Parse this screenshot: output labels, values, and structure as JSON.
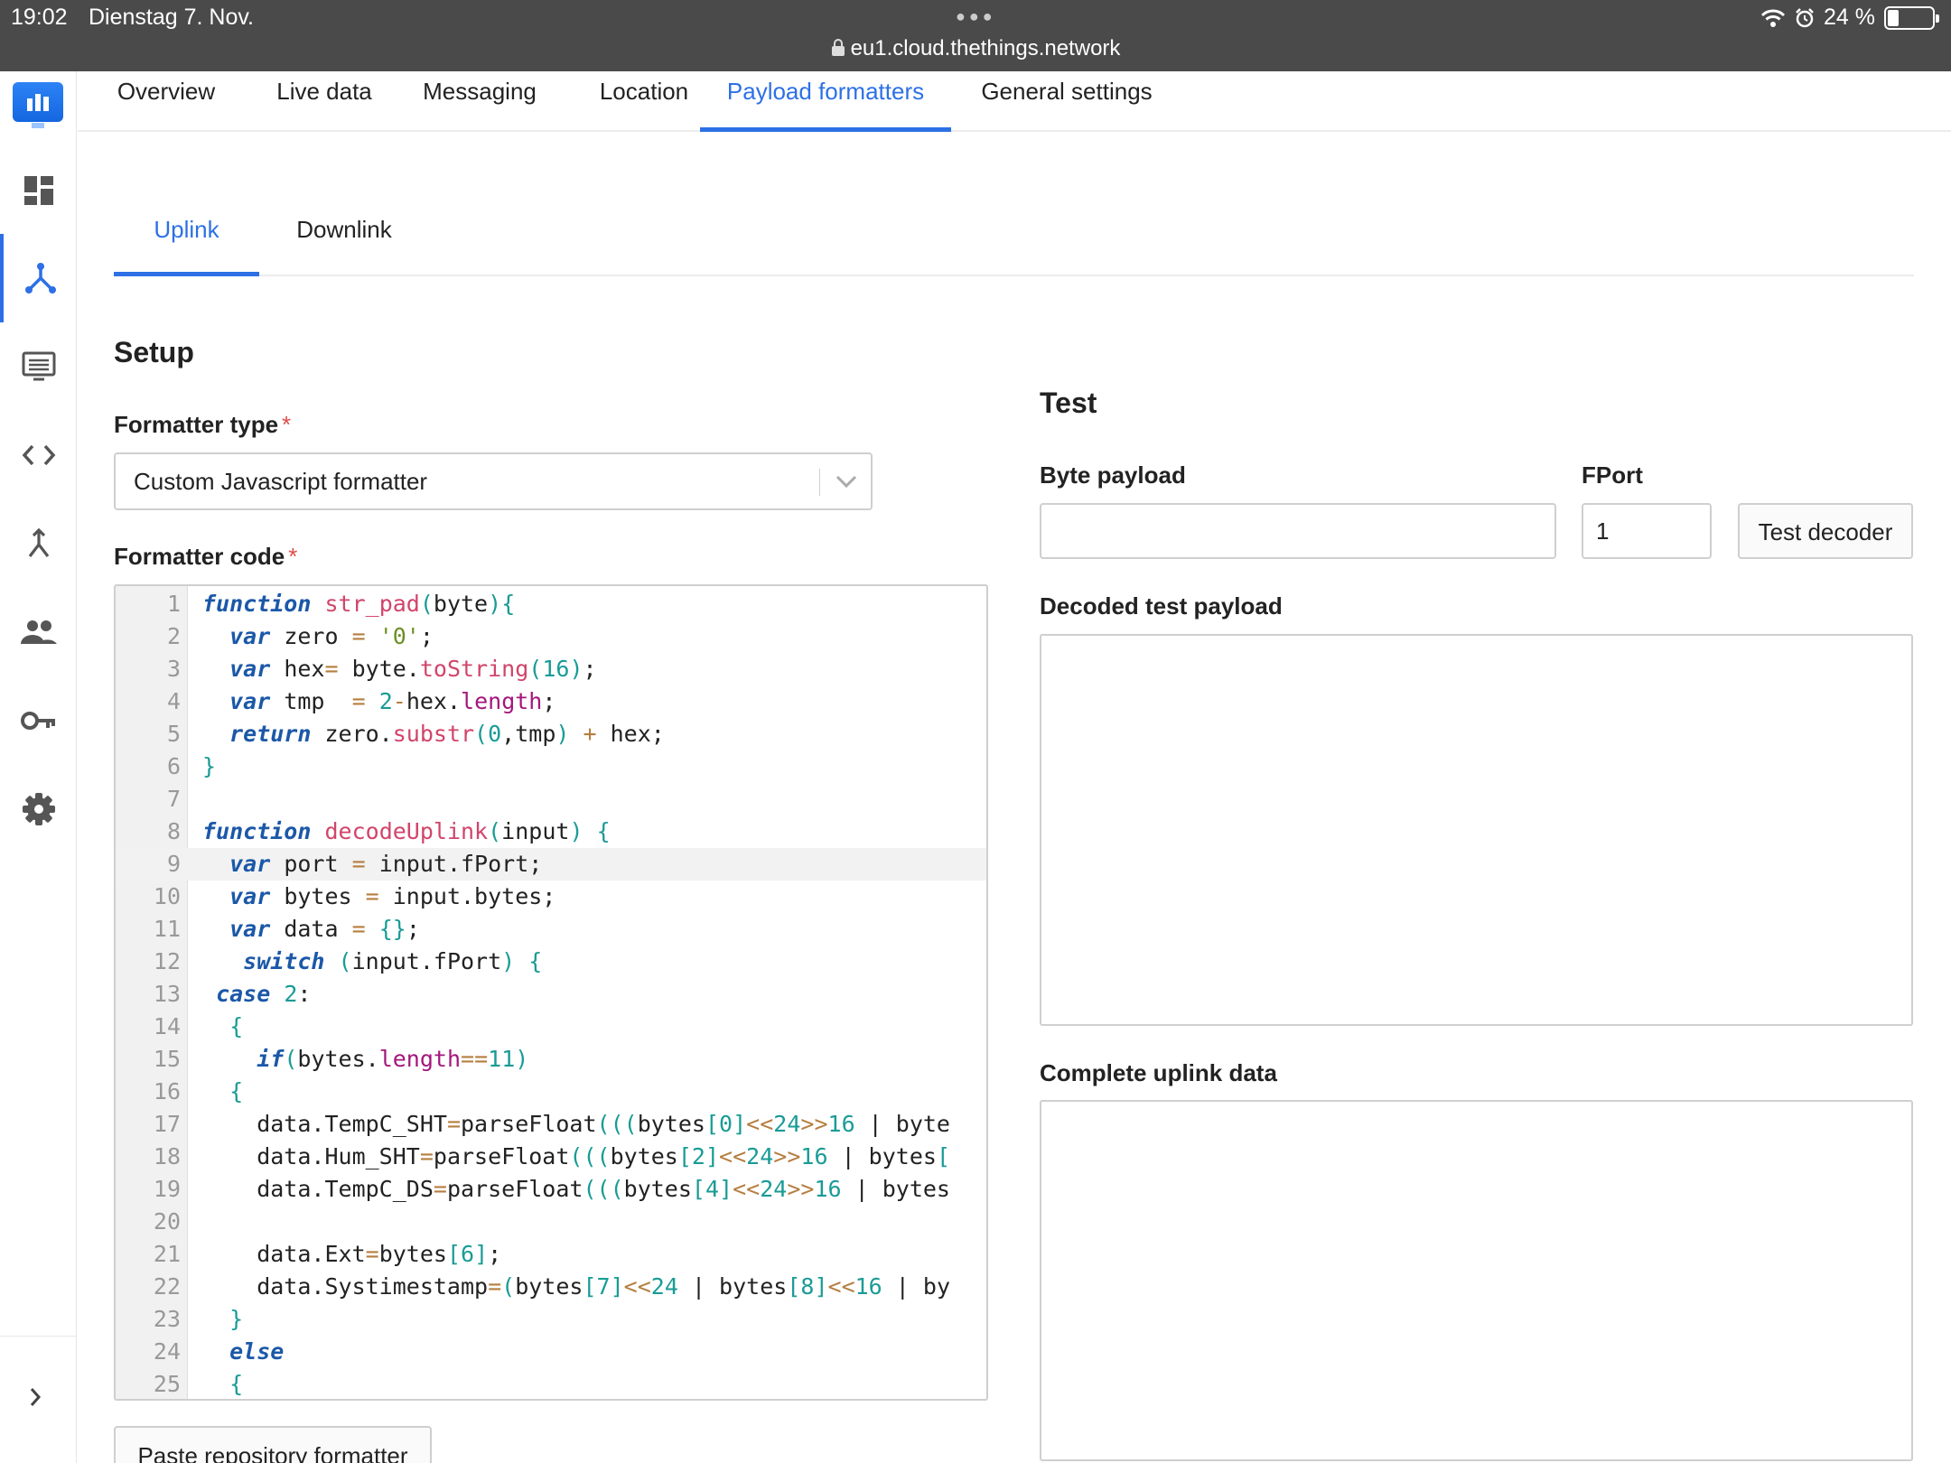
{
  "status_bar": {
    "time": "19:02",
    "date": "Dienstag 7. Nov.",
    "url": "eu1.cloud.thethings.network",
    "battery": "24 %",
    "battery_level": 0.24
  },
  "sidebar": {
    "items": [
      {
        "icon": "dashboard-icon"
      },
      {
        "icon": "applications-icon",
        "active": true
      },
      {
        "icon": "gateways-icon"
      },
      {
        "icon": "code-icon"
      },
      {
        "icon": "merge-icon"
      },
      {
        "icon": "people-icon"
      },
      {
        "icon": "key-icon"
      },
      {
        "icon": "gear-icon"
      }
    ],
    "collapse_icon": "chevron-right-icon"
  },
  "top_tabs": [
    {
      "label": "Overview"
    },
    {
      "label": "Live data"
    },
    {
      "label": "Messaging"
    },
    {
      "label": "Location"
    },
    {
      "label": "Payload formatters",
      "active": true
    },
    {
      "label": "General settings"
    }
  ],
  "sub_tabs": [
    {
      "label": "Uplink",
      "active": true
    },
    {
      "label": "Downlink"
    }
  ],
  "setup": {
    "title": "Setup",
    "formatter_type_label": "Formatter type",
    "formatter_type_value": "Custom Javascript formatter",
    "formatter_code_label": "Formatter code",
    "required_mark": "*",
    "paste_button": "Paste repository formatter"
  },
  "code_lines": [
    "function str_pad(byte){",
    "  var zero = '0';",
    "  var hex= byte.toString(16);",
    "  var tmp  = 2-hex.length;",
    "  return zero.substr(0,tmp) + hex;",
    "}",
    "",
    "function decodeUplink(input) {",
    "  var port = input.fPort;",
    "  var bytes = input.bytes;",
    "  var data = {};",
    "   switch (input.fPort) {",
    " case 2:",
    "  {",
    "    if(bytes.length==11)",
    "  {",
    "    data.TempC_SHT=parseFloat(((bytes[0]<<24>>16 | byte",
    "    data.Hum_SHT=parseFloat(((bytes[2]<<24>>16 | bytes[",
    "    data.TempC_DS=parseFloat(((bytes[4]<<24>>16 | bytes",
    "",
    "    data.Ext=bytes[6];",
    "    data.Systimestamp=(bytes[7]<<24 | bytes[8]<<16 | by",
    "  }",
    "  else",
    "  {"
  ],
  "test": {
    "title": "Test",
    "byte_payload_label": "Byte payload",
    "byte_payload_value": "",
    "fport_label": "FPort",
    "fport_value": "1",
    "test_button": "Test decoder",
    "decoded_label": "Decoded test payload",
    "complete_label": "Complete uplink data"
  },
  "colors": {
    "accent": "#2d70e6",
    "status_bar": "#4a4a4a",
    "required": "#e04a4a"
  }
}
